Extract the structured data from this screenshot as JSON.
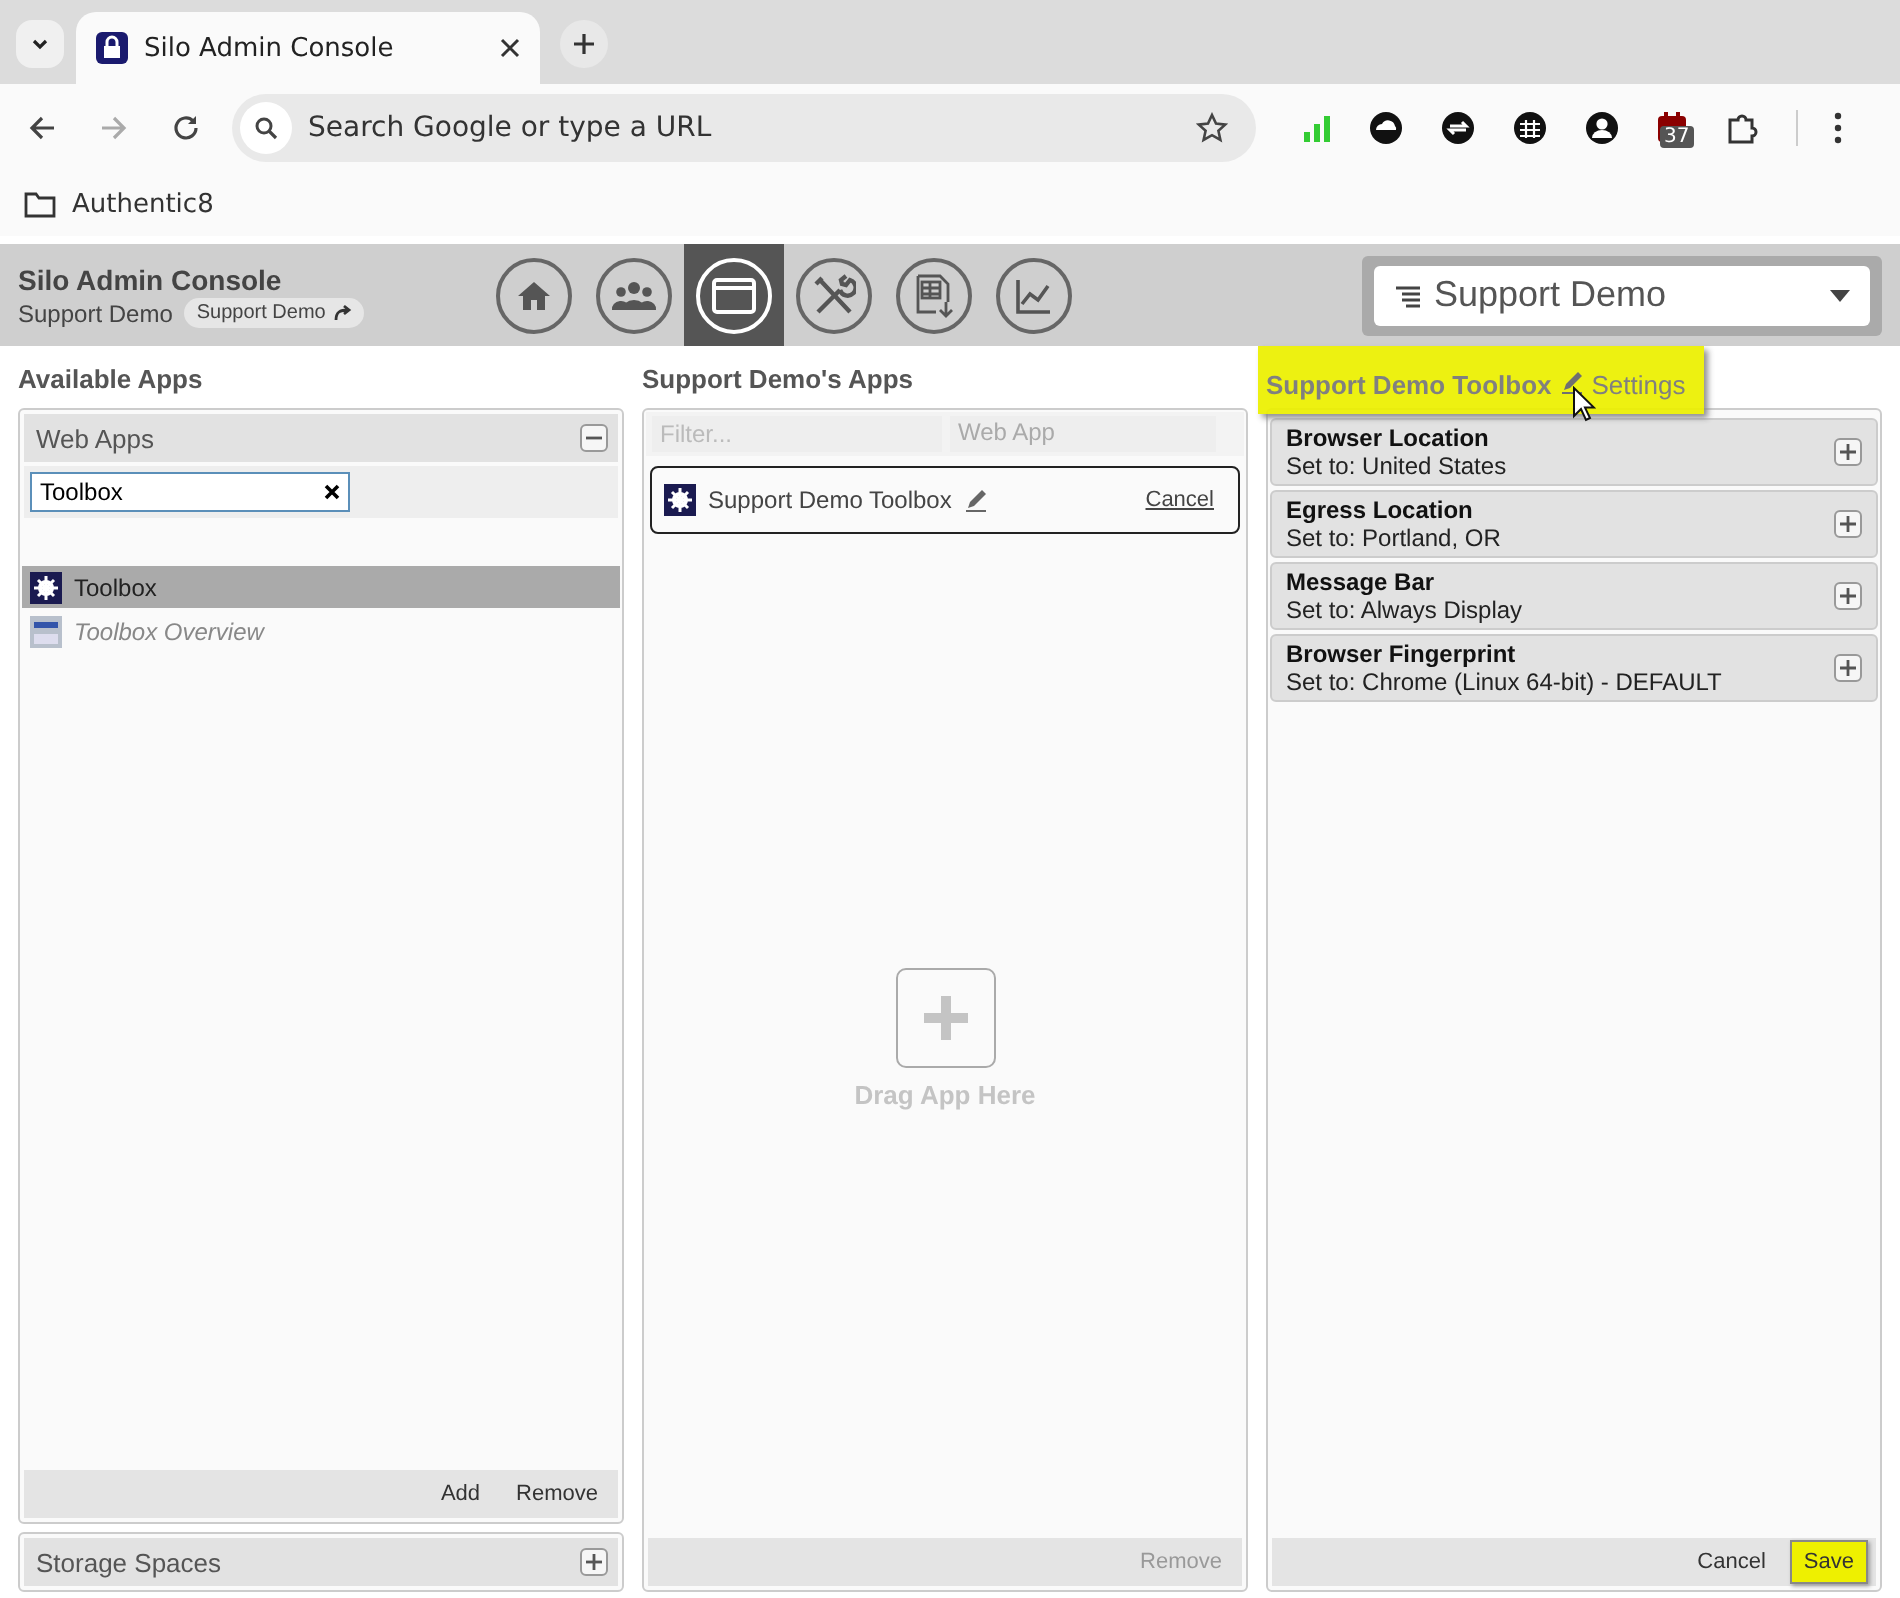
{
  "browser": {
    "tab_title": "Silo Admin Console",
    "address_placeholder": "Search Google or type a URL",
    "extension_badge": "37",
    "bookmark": "Authentic8"
  },
  "header": {
    "title": "Silo Admin Console",
    "subtitle": "Support Demo",
    "chip": "Support Demo",
    "nav": [
      {
        "kind": "home",
        "selected": false
      },
      {
        "kind": "users",
        "selected": false
      },
      {
        "kind": "window",
        "selected": true
      },
      {
        "kind": "tools",
        "selected": false
      },
      {
        "kind": "export",
        "selected": false
      },
      {
        "kind": "chart",
        "selected": false
      }
    ],
    "org_select": "Support Demo"
  },
  "available_apps": {
    "heading": "Available Apps",
    "web_apps": {
      "title": "Web Apps",
      "expanded": true,
      "filter_value": "Toolbox",
      "items": [
        {
          "label": "Toolbox",
          "kind": "gear",
          "selected": true,
          "disabled": false
        },
        {
          "label": "Toolbox Overview",
          "kind": "logo",
          "selected": false,
          "disabled": true
        }
      ],
      "buttons": [
        "Add",
        "Remove"
      ]
    },
    "storage_spaces": {
      "title": "Storage Spaces",
      "expanded": false
    }
  },
  "assigned_apps": {
    "heading": "Support Demo's Apps",
    "filter_placeholder": "Filter...",
    "type_select": "Web App",
    "app": {
      "name": "Support Demo Toolbox",
      "cancel": "Cancel"
    },
    "dropzone": "Drag App Here",
    "remove_button": {
      "label": "Remove",
      "disabled": true
    }
  },
  "toolbox": {
    "title": "Support Demo Toolbox",
    "settings_link": "Settings",
    "settings": [
      {
        "name": "Browser Location",
        "value": "Set to: United States"
      },
      {
        "name": "Egress Location",
        "value": "Set to: Portland, OR"
      },
      {
        "name": "Message Bar",
        "value": "Set to: Always Display"
      },
      {
        "name": "Browser Fingerprint",
        "value": "Set to: Chrome (Linux 64-bit) - DEFAULT"
      }
    ],
    "cancel": "Cancel",
    "save": "Save"
  }
}
